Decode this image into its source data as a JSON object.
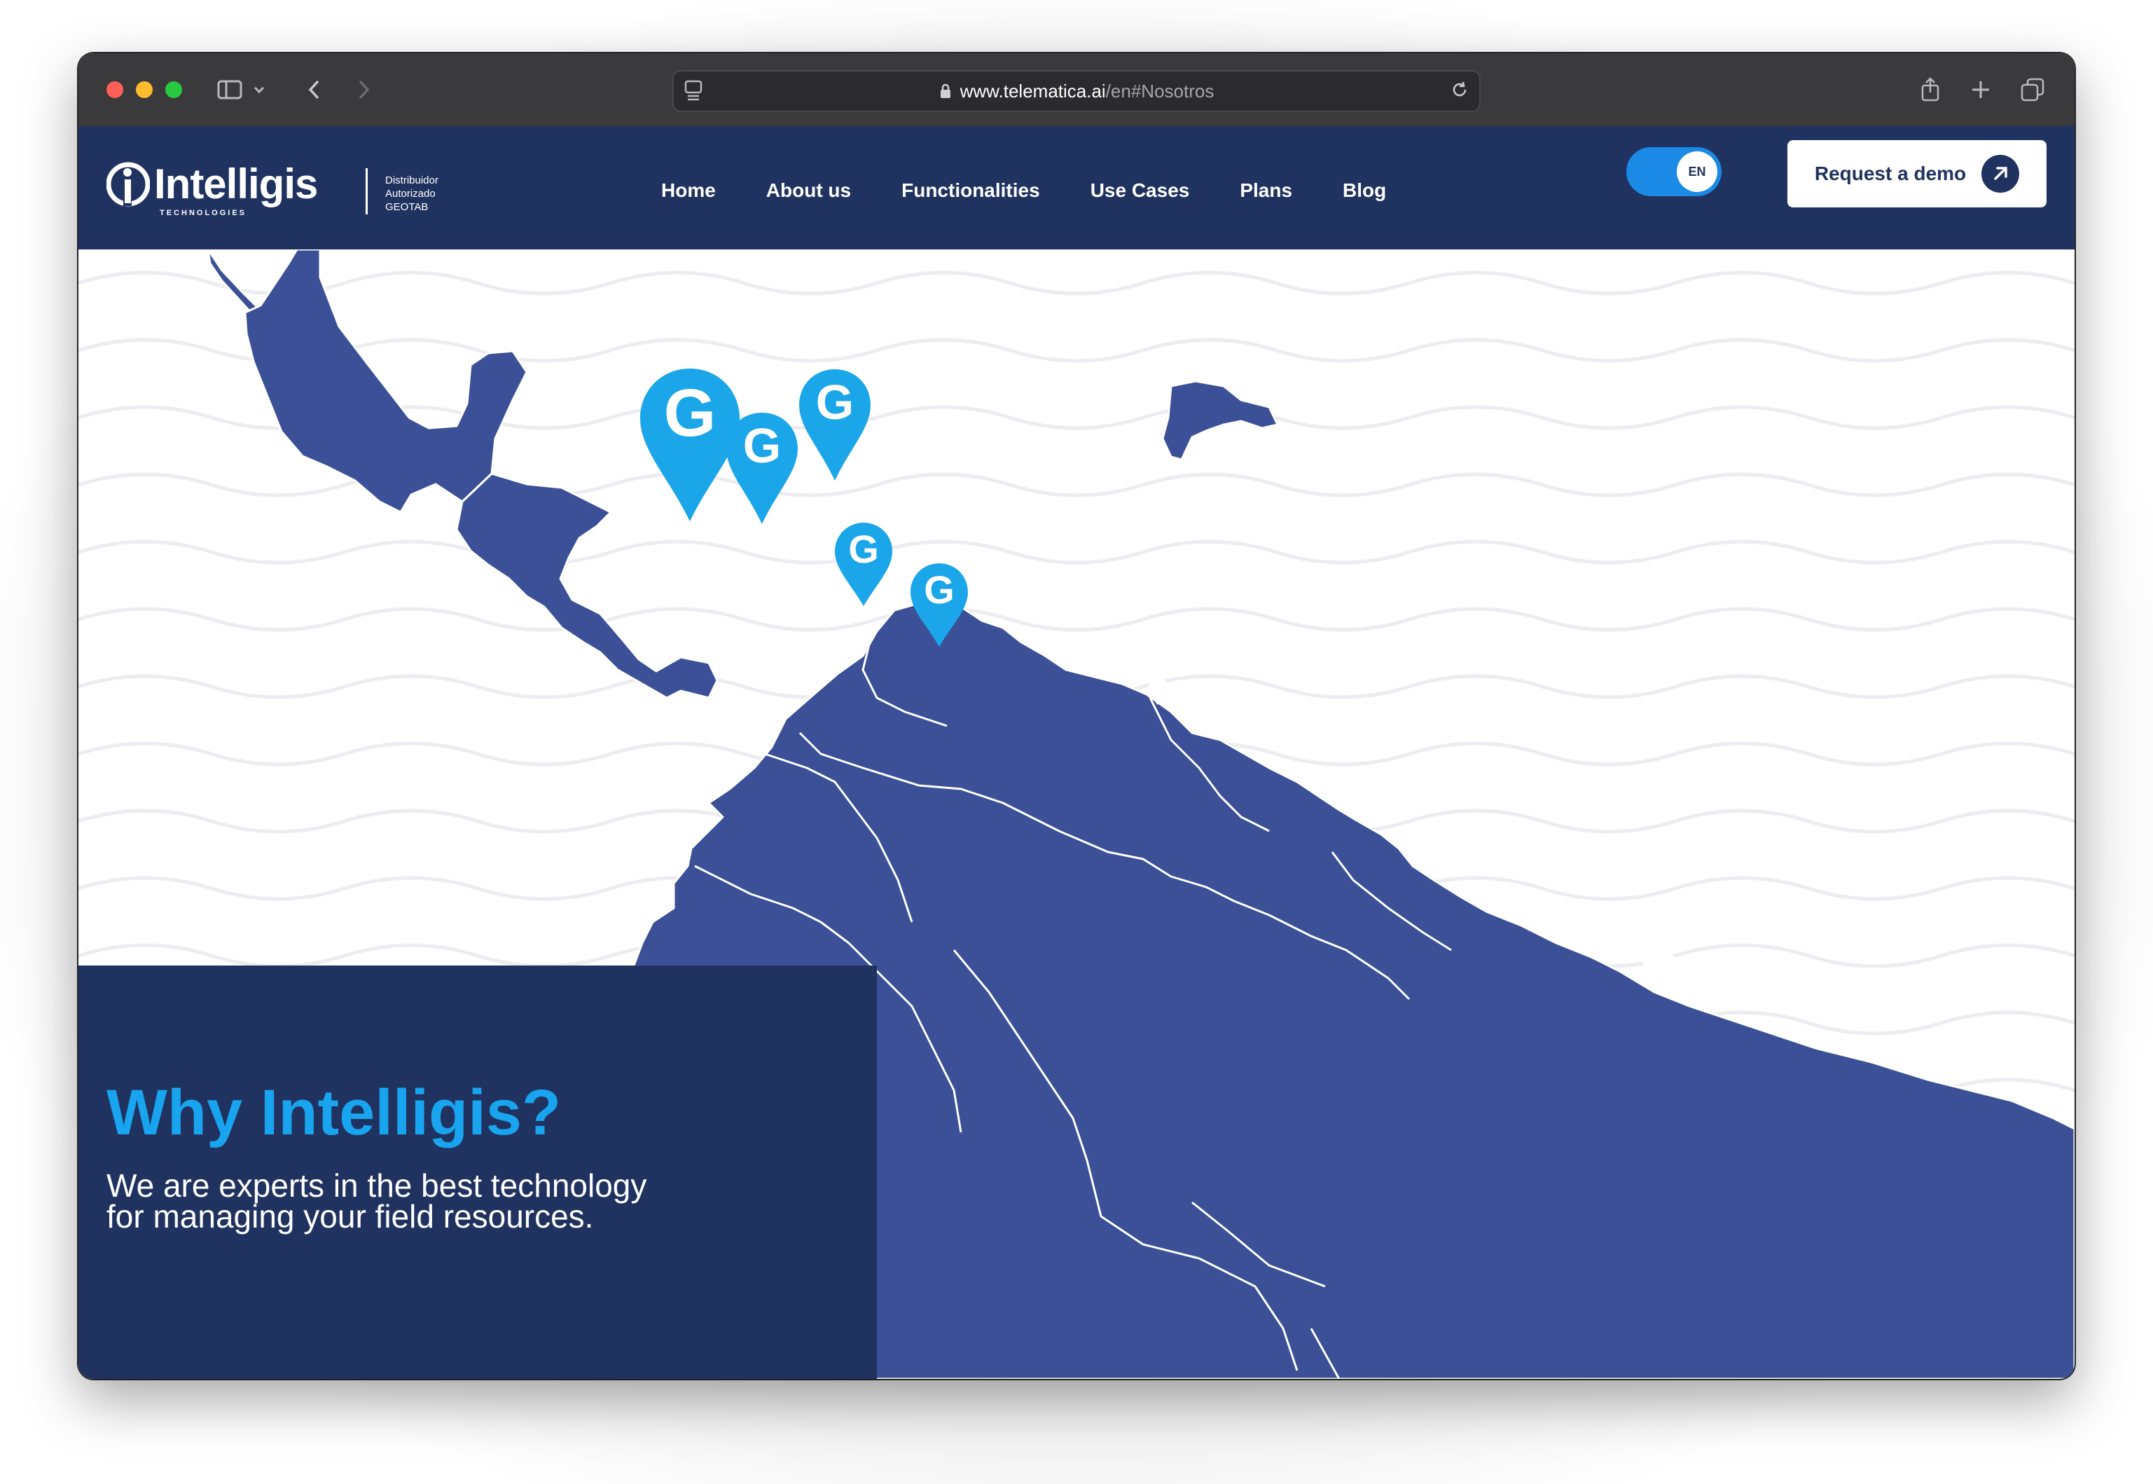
{
  "browser": {
    "url_domain": "www.telematica.ai",
    "url_path": "/en#Nosotros",
    "icons": [
      "sidebar-icon",
      "chevron-down-icon",
      "back-icon",
      "forward-icon",
      "reader-icon",
      "lock-icon",
      "reload-icon",
      "share-icon",
      "new-tab-icon",
      "tabs-icon"
    ]
  },
  "header": {
    "logo_name": "Intelligis",
    "logo_sub": "TECHNOLOGIES",
    "dist_line1": "Distribuidor",
    "dist_line2": "Autorizado",
    "dist_line3": "GEOTAB",
    "nav": [
      "Home",
      "About us",
      "Functionalities",
      "Use Cases",
      "Plans",
      "Blog"
    ],
    "lang": "EN",
    "demo_label": "Request a demo"
  },
  "hero": {
    "title": "Why Intelligis?",
    "subtitle": "We are experts in the best technology for managing your field resources."
  },
  "map": {
    "land_color": "#3b5097",
    "pin_color": "#1ba6e9",
    "pin_letter": "G"
  },
  "colors": {
    "navy": "#20325f",
    "accent": "#18a4ee",
    "chrome": "#3a393c"
  }
}
